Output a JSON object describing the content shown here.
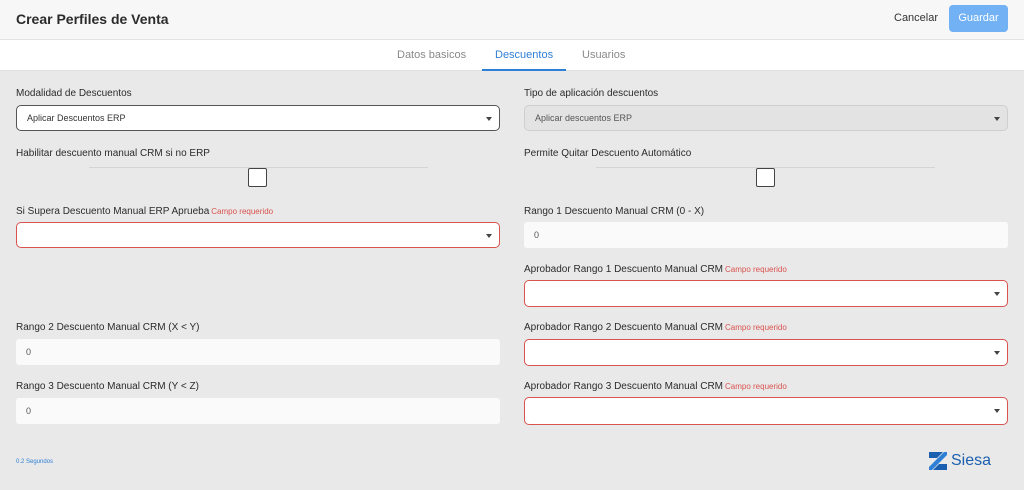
{
  "header": {
    "title": "Crear Perfiles de Venta",
    "cancel_label": "Cancelar",
    "save_label": "Guardar"
  },
  "tabs": [
    {
      "label": "Datos basicos",
      "active": false
    },
    {
      "label": "Descuentos",
      "active": true
    },
    {
      "label": "Usuarios",
      "active": false
    }
  ],
  "form": {
    "modalidad": {
      "label": "Modalidad de Descuentos",
      "value": "Aplicar Descuentos ERP"
    },
    "tipo_aplicacion": {
      "label": "Tipo de aplicación descuentos",
      "value": "Aplicar descuentos ERP"
    },
    "habilitar_manual": {
      "label": "Habilitar descuento manual CRM si no ERP",
      "checked": false
    },
    "permite_quitar": {
      "label": "Permite Quitar Descuento Automático",
      "checked": false
    },
    "si_supera": {
      "label": "Si Supera Descuento Manual ERP Aprueba",
      "required_text": "Campo requerido",
      "value": ""
    },
    "rango1": {
      "label": "Rango 1 Descuento Manual CRM (0 - X)",
      "value": "0"
    },
    "aprobador1": {
      "label": "Aprobador Rango 1 Descuento Manual CRM",
      "required_text": "Campo requerido",
      "value": ""
    },
    "rango2": {
      "label": "Rango 2 Descuento Manual CRM (X < Y)",
      "value": "0"
    },
    "aprobador2": {
      "label": "Aprobador Rango 2 Descuento Manual CRM",
      "required_text": "Campo requerido",
      "value": ""
    },
    "rango3": {
      "label": "Rango 3 Descuento Manual CRM (Y < Z)",
      "value": "0"
    },
    "aprobador3": {
      "label": "Aprobador Rango 3 Descuento Manual CRM",
      "required_text": "Campo requerido",
      "value": ""
    }
  },
  "footer": {
    "timing": "0.2 Segundos",
    "logo_text": "Siesa"
  },
  "colors": {
    "accent": "#2f7fd6",
    "save_button": "#71b1f4",
    "error": "#d9534f",
    "logo": "#1b5fb0"
  }
}
